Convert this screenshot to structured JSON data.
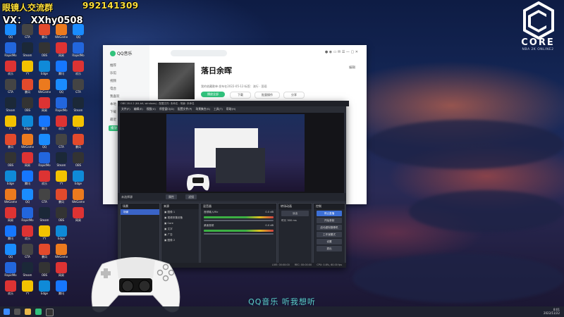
{
  "overlay": {
    "qq_group_text": "眼镜人交流群",
    "qq_group_number": "992141309",
    "wechat": "VX：_XXhy0508"
  },
  "logo": {
    "word": "CORE",
    "subtitle": "NBA 2K ONLINE2"
  },
  "desktop_icons": [
    {
      "label": "QQ",
      "color": "#1a8cff"
    },
    {
      "label": "RapidMo",
      "color": "#2266dd"
    },
    {
      "label": "欢乐",
      "color": "#dd3333"
    },
    {
      "label": "GTA",
      "color": "#444444"
    },
    {
      "label": "Steam",
      "color": "#1b2838"
    },
    {
      "label": "YY",
      "color": "#f2c200"
    },
    {
      "label": "暴风",
      "color": "#e24a2c"
    },
    {
      "label": "OBS",
      "color": "#333333"
    },
    {
      "label": "Edge",
      "color": "#0f8ad8"
    },
    {
      "label": "WeGame",
      "color": "#ec7a1e"
    },
    {
      "label": "网易",
      "color": "#d33"
    },
    {
      "label": "腾讯",
      "color": "#1677ff"
    }
  ],
  "qq_music": {
    "brand": "QQ音乐",
    "nav": [
      "推荐",
      "乐馆",
      "视频",
      "电台",
      "我喜欢",
      "本地",
      "下载",
      "最近",
      "播放"
    ],
    "active_nav": "播放",
    "search_placeholder": "搜索",
    "playlist_title": "落日余晖",
    "playlist_info": "我的收藏歌单·发布在2022-05-12·标签：流行 · 国语",
    "buttons": {
      "play_all": "播放全部",
      "download": "下载",
      "batch": "批量操作",
      "share": "分享"
    },
    "edit": "编辑"
  },
  "obs": {
    "title": "OBS 28.0.2 (64-bit, windows) - 配置文件: 未命名 - 场景: 未命名",
    "menu": [
      "文件(F)",
      "编辑(E)",
      "视图(V)",
      "停靠窗口(D)",
      "配置文件(P)",
      "场景集合(S)",
      "工具(T)",
      "帮助(H)"
    ],
    "strip": {
      "source": "未选择源",
      "props": "属性",
      "filter": "滤镜"
    },
    "docks": {
      "scenes": {
        "title": "场景",
        "items": [
          "场景"
        ]
      },
      "sources": {
        "title": "来源",
        "items": [
          "图像 1",
          "视频采集设备",
          "Core",
          "文字",
          "广告",
          "图像 2"
        ]
      },
      "mixer": {
        "title": "混音器",
        "channels": [
          {
            "name": "音频输入Mic",
            "level": "0.0 dB"
          },
          {
            "name": "桌面音频",
            "level": "0.0 dB"
          }
        ]
      },
      "transitions": {
        "title": "转场动画",
        "type": "淡出",
        "duration_label": "时长",
        "duration": "300 ms"
      },
      "controls": {
        "title": "控制",
        "buttons": [
          "停止直播",
          "开始录制",
          "启动虚拟摄像机",
          "工作室模式",
          "设置",
          "退出"
        ]
      }
    },
    "status": {
      "live": "LIVE: 00:00:00",
      "rec": "REC: 00:00:00",
      "cpu": "CPU: 0.8%, 60.00 fps"
    }
  },
  "lyric": "QQ音乐 听我想听",
  "tray": {
    "time": "8:01",
    "date": "2022/11/22"
  }
}
